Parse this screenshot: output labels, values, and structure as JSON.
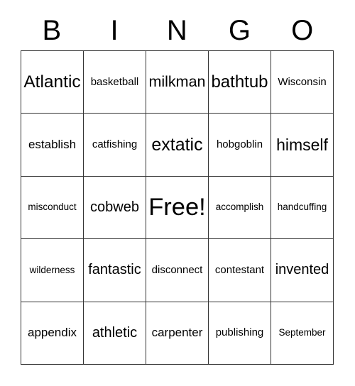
{
  "card": {
    "header_letters": [
      "B",
      "I",
      "N",
      "G",
      "O"
    ],
    "free_space_label": "Free!",
    "grid": {
      "columns": 5,
      "rows": 5,
      "cells": [
        [
          {
            "label": "Atlantic",
            "size": "fs-xl"
          },
          {
            "label": "basketball",
            "size": "fs-xs"
          },
          {
            "label": "milkman",
            "size": "fs-lg"
          },
          {
            "label": "bathtub",
            "size": "fs-xl"
          },
          {
            "label": "Wisconsin",
            "size": "fs-xs"
          }
        ],
        [
          {
            "label": "establish",
            "size": "fs-sm"
          },
          {
            "label": "catfishing",
            "size": "fs-xs"
          },
          {
            "label": "extatic",
            "size": "fs-xl"
          },
          {
            "label": "hobgoblin",
            "size": "fs-xs"
          },
          {
            "label": "himself",
            "size": "fs-lg"
          }
        ],
        [
          {
            "label": "misconduct",
            "size": "fs-xxs"
          },
          {
            "label": "cobweb",
            "size": "fs-md"
          },
          {
            "label": "Free!",
            "size": "fs-xxl"
          },
          {
            "label": "accomplish",
            "size": "fs-xxs"
          },
          {
            "label": "handcuffing",
            "size": "fs-xxs"
          }
        ],
        [
          {
            "label": "wilderness",
            "size": "fs-xxs"
          },
          {
            "label": "fantastic",
            "size": "fs-md"
          },
          {
            "label": "disconnect",
            "size": "fs-xs"
          },
          {
            "label": "contestant",
            "size": "fs-xs"
          },
          {
            "label": "invented",
            "size": "fs-md"
          }
        ],
        [
          {
            "label": "appendix",
            "size": "fs-sm"
          },
          {
            "label": "athletic",
            "size": "fs-md"
          },
          {
            "label": "carpenter",
            "size": "fs-sm"
          },
          {
            "label": "publishing",
            "size": "fs-xs"
          },
          {
            "label": "September",
            "size": "fs-xxs"
          }
        ]
      ]
    },
    "colors": {
      "background": "#ffffff",
      "text": "#000000",
      "grid_line": "#333333"
    }
  }
}
